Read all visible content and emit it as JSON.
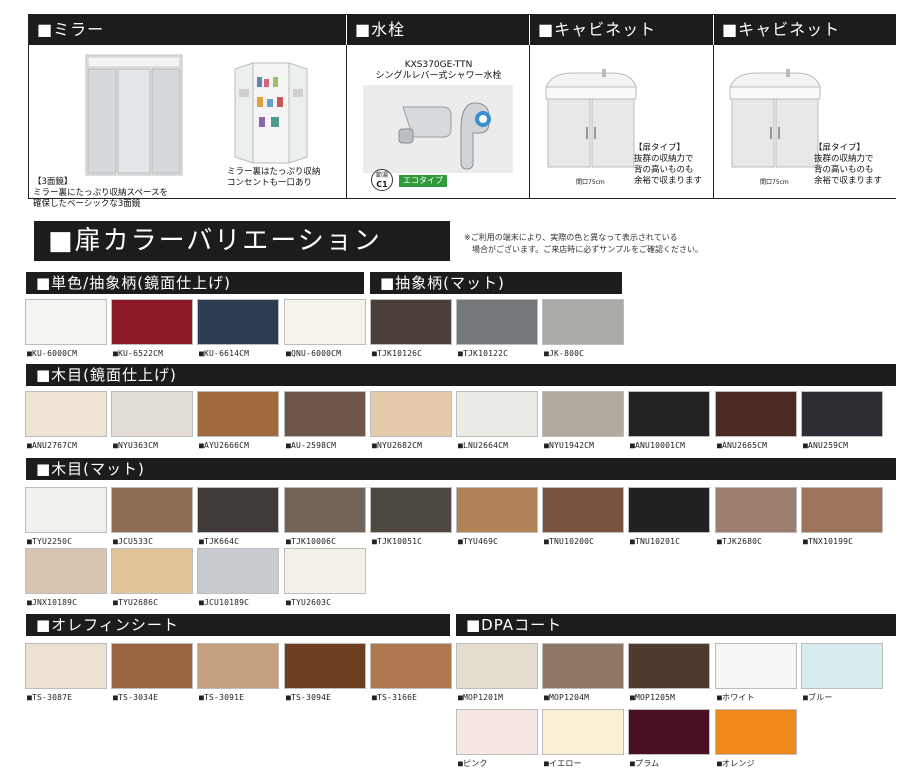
{
  "top": {
    "mirror_header": "■ミラー",
    "faucet_header": "■水栓",
    "cabinet1_header": "■キャビネット",
    "cabinet2_header": "■キャビネット",
    "mirror_caption_1": "【3面鏡】",
    "mirror_caption_2": "ミラー裏にたっぷり収納スペースを",
    "mirror_caption_3": "確保したベーシックな3面鏡",
    "mirror_open_caption_1": "ミラー裏はたっぷり収納",
    "mirror_open_caption_2": "コンセントも一口あり",
    "faucet_model": "KXS370GE-TTN",
    "faucet_desc": "シングルレバー式シャワー水栓",
    "faucet_badge_1": "節湯",
    "faucet_badge_2": "C1",
    "eco_label": "エコタイプ",
    "cab_depth": "間口75cm",
    "cab_caption_1": "【扉タイプ】",
    "cab_caption_2": "抜群の収納力で",
    "cab_caption_3": "背の高いものも",
    "cab_caption_4": "余裕で収まります"
  },
  "title": "■扉カラーバリエーション",
  "note_1": "※ご利用の端末により、実際の色と異なって表示されている",
  "note_2": "　場合がございます。ご来店時に必ずサンプルをご確認ください。",
  "sections": {
    "solid": "■単色/抽象柄(鏡面仕上げ)",
    "abstract_matte": "■抽象柄(マット)",
    "wood_gloss": "■木目(鏡面仕上げ)",
    "wood_matte": "■木目(マット)",
    "olefin": "■オレフィンシート",
    "dpa": "■DPAコート"
  },
  "colors": {
    "r1": [
      {
        "label": "■KU-6000CM",
        "color": "#f4f4f1"
      },
      {
        "label": "■KU-6522CM",
        "color": "#8e1a28"
      },
      {
        "label": "■KU-6614CM",
        "color": "#2e3c52"
      },
      {
        "label": "■QNU-6000CM",
        "color": "#f6f3ec"
      },
      {
        "label": "■TJK10126C",
        "color": "#4b3f3c"
      },
      {
        "label": "■TJK10122C",
        "color": "#75787a"
      },
      {
        "label": "■JK-800C",
        "color": "#a9aba6"
      }
    ],
    "r2": [
      {
        "label": "■ANU2767CM",
        "color": "#ede4d4"
      },
      {
        "label": "■NYU363CM",
        "color": "#e2ddd4"
      },
      {
        "label": "■AYU2666CM",
        "color": "#a06a3e"
      },
      {
        "label": "■AU-2598CM",
        "color": "#6d5548"
      },
      {
        "label": "■NYU2682CM",
        "color": "#e3cbab"
      },
      {
        "label": "■LNU2664CM",
        "color": "#ecebe6"
      },
      {
        "label": "■NYU1942CM",
        "color": "#b1aa9e"
      },
      {
        "label": "■ANU10001CM",
        "color": "#222222"
      },
      {
        "label": "■ANU2665CM",
        "color": "#4b2a22"
      },
      {
        "label": "■ANU259CM",
        "color": "#2e2d33"
      }
    ],
    "r3": [
      {
        "label": "■TYU2250C",
        "color": "#f2f0ec"
      },
      {
        "label": "■JCU533C",
        "color": "#8f6d52"
      },
      {
        "label": "■TJK664C",
        "color": "#3f3a38"
      },
      {
        "label": "■TJK10006C",
        "color": "#726458"
      },
      {
        "label": "■TJK10051C",
        "color": "#4e4843"
      },
      {
        "label": "■TYU469C",
        "color": "#b08357"
      },
      {
        "label": "■TNU10200C",
        "color": "#7a5340"
      },
      {
        "label": "■TNU10201C",
        "color": "#222020"
      },
      {
        "label": "■TJK2680C",
        "color": "#9c7f6f"
      },
      {
        "label": "■TNX10199C",
        "color": "#9c7459"
      }
    ],
    "r4": [
      {
        "label": "■JNX10189C",
        "color": "#d8c6b3"
      },
      {
        "label": "■TYU2686C",
        "color": "#e4c49b"
      },
      {
        "label": "■JCU10189C",
        "color": "#c8ccd1"
      },
      {
        "label": "■TYU2603C",
        "color": "#f4f1ea"
      }
    ],
    "r5": [
      {
        "label": "■TS-3087E",
        "color": "#ece2d4"
      },
      {
        "label": "■TS-3034E",
        "color": "#9b6543"
      },
      {
        "label": "■TS-3091E",
        "color": "#c6a17f"
      },
      {
        "label": "■TS-3094E",
        "color": "#6d3f22"
      },
      {
        "label": "■TS-3166E",
        "color": "#b07850"
      },
      {
        "label": "■MOP1201M",
        "color": "#e3ddd0"
      },
      {
        "label": "■MOP1204M",
        "color": "#8f7765"
      },
      {
        "label": "■MOP1205M",
        "color": "#4f3a2f"
      },
      {
        "label": "■ホワイト",
        "color": "#f7f7f5"
      },
      {
        "label": "■ブルー",
        "color": "#d6ecec"
      }
    ],
    "r6": [
      {
        "label": "■ピンク",
        "color": "#f6e7e2"
      },
      {
        "label": "■イエロー",
        "color": "#f8f1d4"
      },
      {
        "label": "■プラム",
        "color": "#4b0f22"
      },
      {
        "label": "■オレンジ",
        "color": "#ef8a1a"
      }
    ]
  }
}
